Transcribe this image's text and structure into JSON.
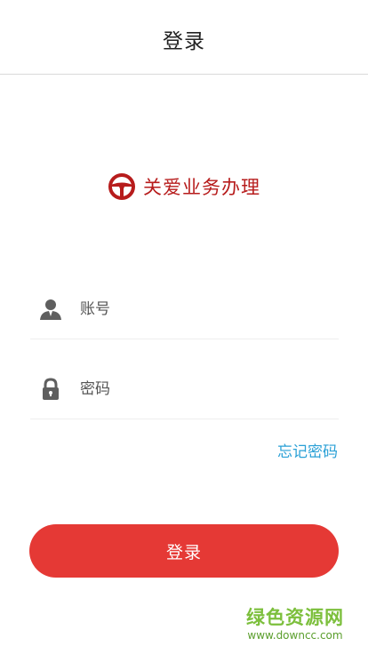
{
  "header": {
    "title": "登录"
  },
  "brand": {
    "name": "关爱业务办理",
    "icon": "steering-wheel-icon",
    "color": "#b71c1c"
  },
  "form": {
    "account": {
      "placeholder": "账号",
      "value": "",
      "icon": "user-icon"
    },
    "password": {
      "placeholder": "密码",
      "value": "",
      "icon": "lock-icon"
    },
    "forgot_label": "忘记密码",
    "login_label": "登录"
  },
  "watermark": {
    "text": "绿色资源网",
    "url": "www.downcc.com"
  },
  "colors": {
    "accent": "#e53935",
    "link": "#2aa0d6",
    "brand": "#b71c1c"
  }
}
